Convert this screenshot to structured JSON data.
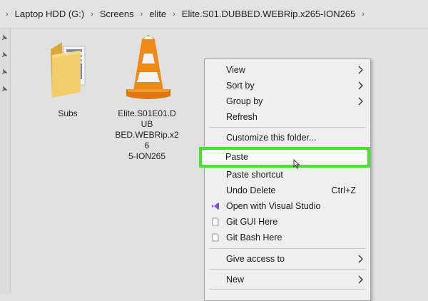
{
  "breadcrumb": {
    "items": [
      "Laptop HDD (G:)",
      "Screens",
      "elite",
      "Elite.S01.DUBBED.WEBRip.x265-ION265"
    ]
  },
  "files": [
    {
      "name": "Subs",
      "icon": "folder-icon"
    },
    {
      "name": "Elite.S01E01.DUBBED.WEBRip.x265-ION265",
      "name_lines": [
        "Elite.S01E01.DUB",
        "BED.WEBRip.x26",
        "5-ION265"
      ],
      "icon": "vlc-cone-icon"
    }
  ],
  "context_menu": {
    "view": "View",
    "sort_by": "Sort by",
    "group_by": "Group by",
    "refresh": "Refresh",
    "customize": "Customize this folder...",
    "paste": "Paste",
    "paste_shortcut": "Paste shortcut",
    "undo_delete": "Undo Delete",
    "undo_delete_shortcut": "Ctrl+Z",
    "open_vs": "Open with Visual Studio",
    "git_gui": "Git GUI Here",
    "git_bash": "Git Bash Here",
    "give_access": "Give access to",
    "new": "New"
  },
  "colors": {
    "highlight": "#49e22f",
    "vs_purple": "#7a53c8",
    "vlc_orange": "#f08a17"
  }
}
